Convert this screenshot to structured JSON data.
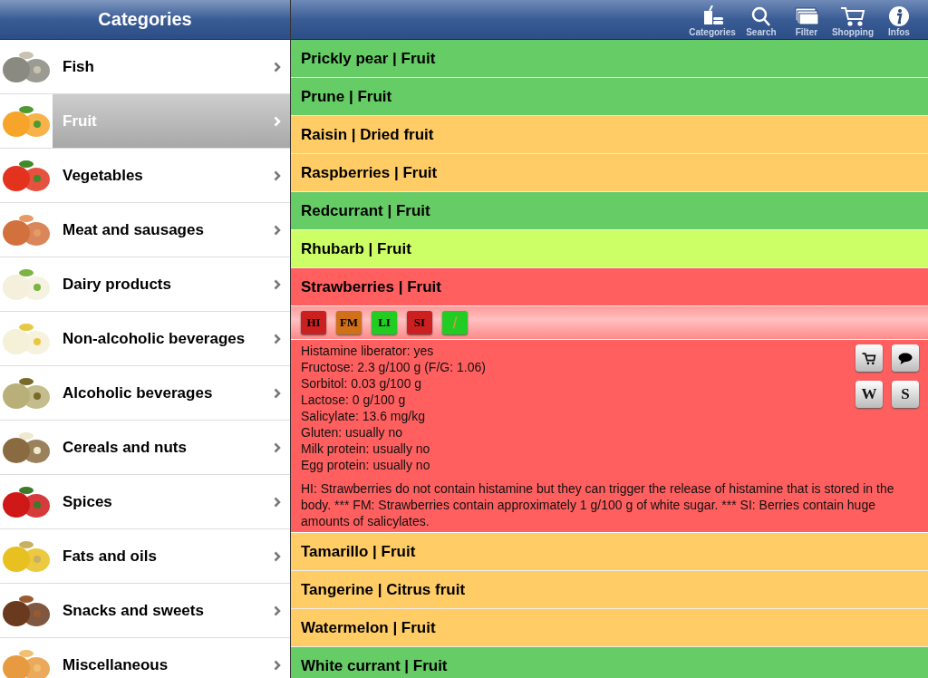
{
  "sidebar": {
    "title": "Categories",
    "items": [
      {
        "label": "Fish",
        "selected": false
      },
      {
        "label": "Fruit",
        "selected": true
      },
      {
        "label": "Vegetables",
        "selected": false
      },
      {
        "label": "Meat and sausages",
        "selected": false
      },
      {
        "label": "Dairy products",
        "selected": false
      },
      {
        "label": "Non-alcoholic beverages",
        "selected": false
      },
      {
        "label": "Alcoholic beverages",
        "selected": false
      },
      {
        "label": "Cereals and nuts",
        "selected": false
      },
      {
        "label": "Spices",
        "selected": false
      },
      {
        "label": "Fats and oils",
        "selected": false
      },
      {
        "label": "Snacks and sweets",
        "selected": false
      },
      {
        "label": "Miscellaneous",
        "selected": false
      }
    ]
  },
  "toolbar": [
    {
      "label": "Categories"
    },
    {
      "label": "Search"
    },
    {
      "label": "Filter"
    },
    {
      "label": "Shopping"
    },
    {
      "label": "Infos"
    }
  ],
  "foods": [
    {
      "label": "Prickly pear | Fruit",
      "color": "#66cc66"
    },
    {
      "label": "Prune | Fruit",
      "color": "#66cc66"
    },
    {
      "label": "Raisin | Dried fruit",
      "color": "#ffcc66"
    },
    {
      "label": "Raspberries | Fruit",
      "color": "#ffcc66"
    },
    {
      "label": "Redcurrant | Fruit",
      "color": "#66cc66"
    },
    {
      "label": "Rhubarb | Fruit",
      "color": "#ccff66"
    },
    {
      "label": "Strawberries | Fruit",
      "color": "#ff5f5f",
      "badges": [
        {
          "kind": "text",
          "label": "HI",
          "color": "#cc1f1f"
        },
        {
          "kind": "text",
          "label": "FM",
          "color": "#d07018"
        },
        {
          "kind": "text",
          "label": "LI",
          "color": "#22cc22"
        },
        {
          "kind": "text",
          "label": "SI",
          "color": "#cc1f1f"
        },
        {
          "kind": "icon",
          "color": "#22cc22"
        }
      ],
      "facts": [
        "Histamine liberator: yes",
        "Fructose: 2.3 g/100 g (F/G: 1.06)",
        "Sorbitol: 0.03 g/100 g",
        "Lactose: 0 g/100 g",
        "Salicylate: 13.6 mg/kg",
        "Gluten: usually no",
        "Milk protein: usually no",
        "Egg protein: usually no"
      ],
      "note": "HI: Strawberries do not contain histamine but they can trigger the release of histamine that is stored in the body. *** FM: Strawberries contain approximately 1 g/100 g of white sugar. *** SI: Berries contain huge amounts of salicylates.",
      "actions": [
        {
          "kind": "cart"
        },
        {
          "kind": "comment"
        },
        {
          "kind": "text",
          "label": "W"
        },
        {
          "kind": "text",
          "label": "S"
        }
      ]
    },
    {
      "label": "Tamarillo | Fruit",
      "color": "#ffcc66"
    },
    {
      "label": "Tangerine | Citrus fruit",
      "color": "#ffcc66"
    },
    {
      "label": "Watermelon | Fruit",
      "color": "#ffcc66"
    },
    {
      "label": "White currant | Fruit",
      "color": "#66cc66"
    }
  ]
}
